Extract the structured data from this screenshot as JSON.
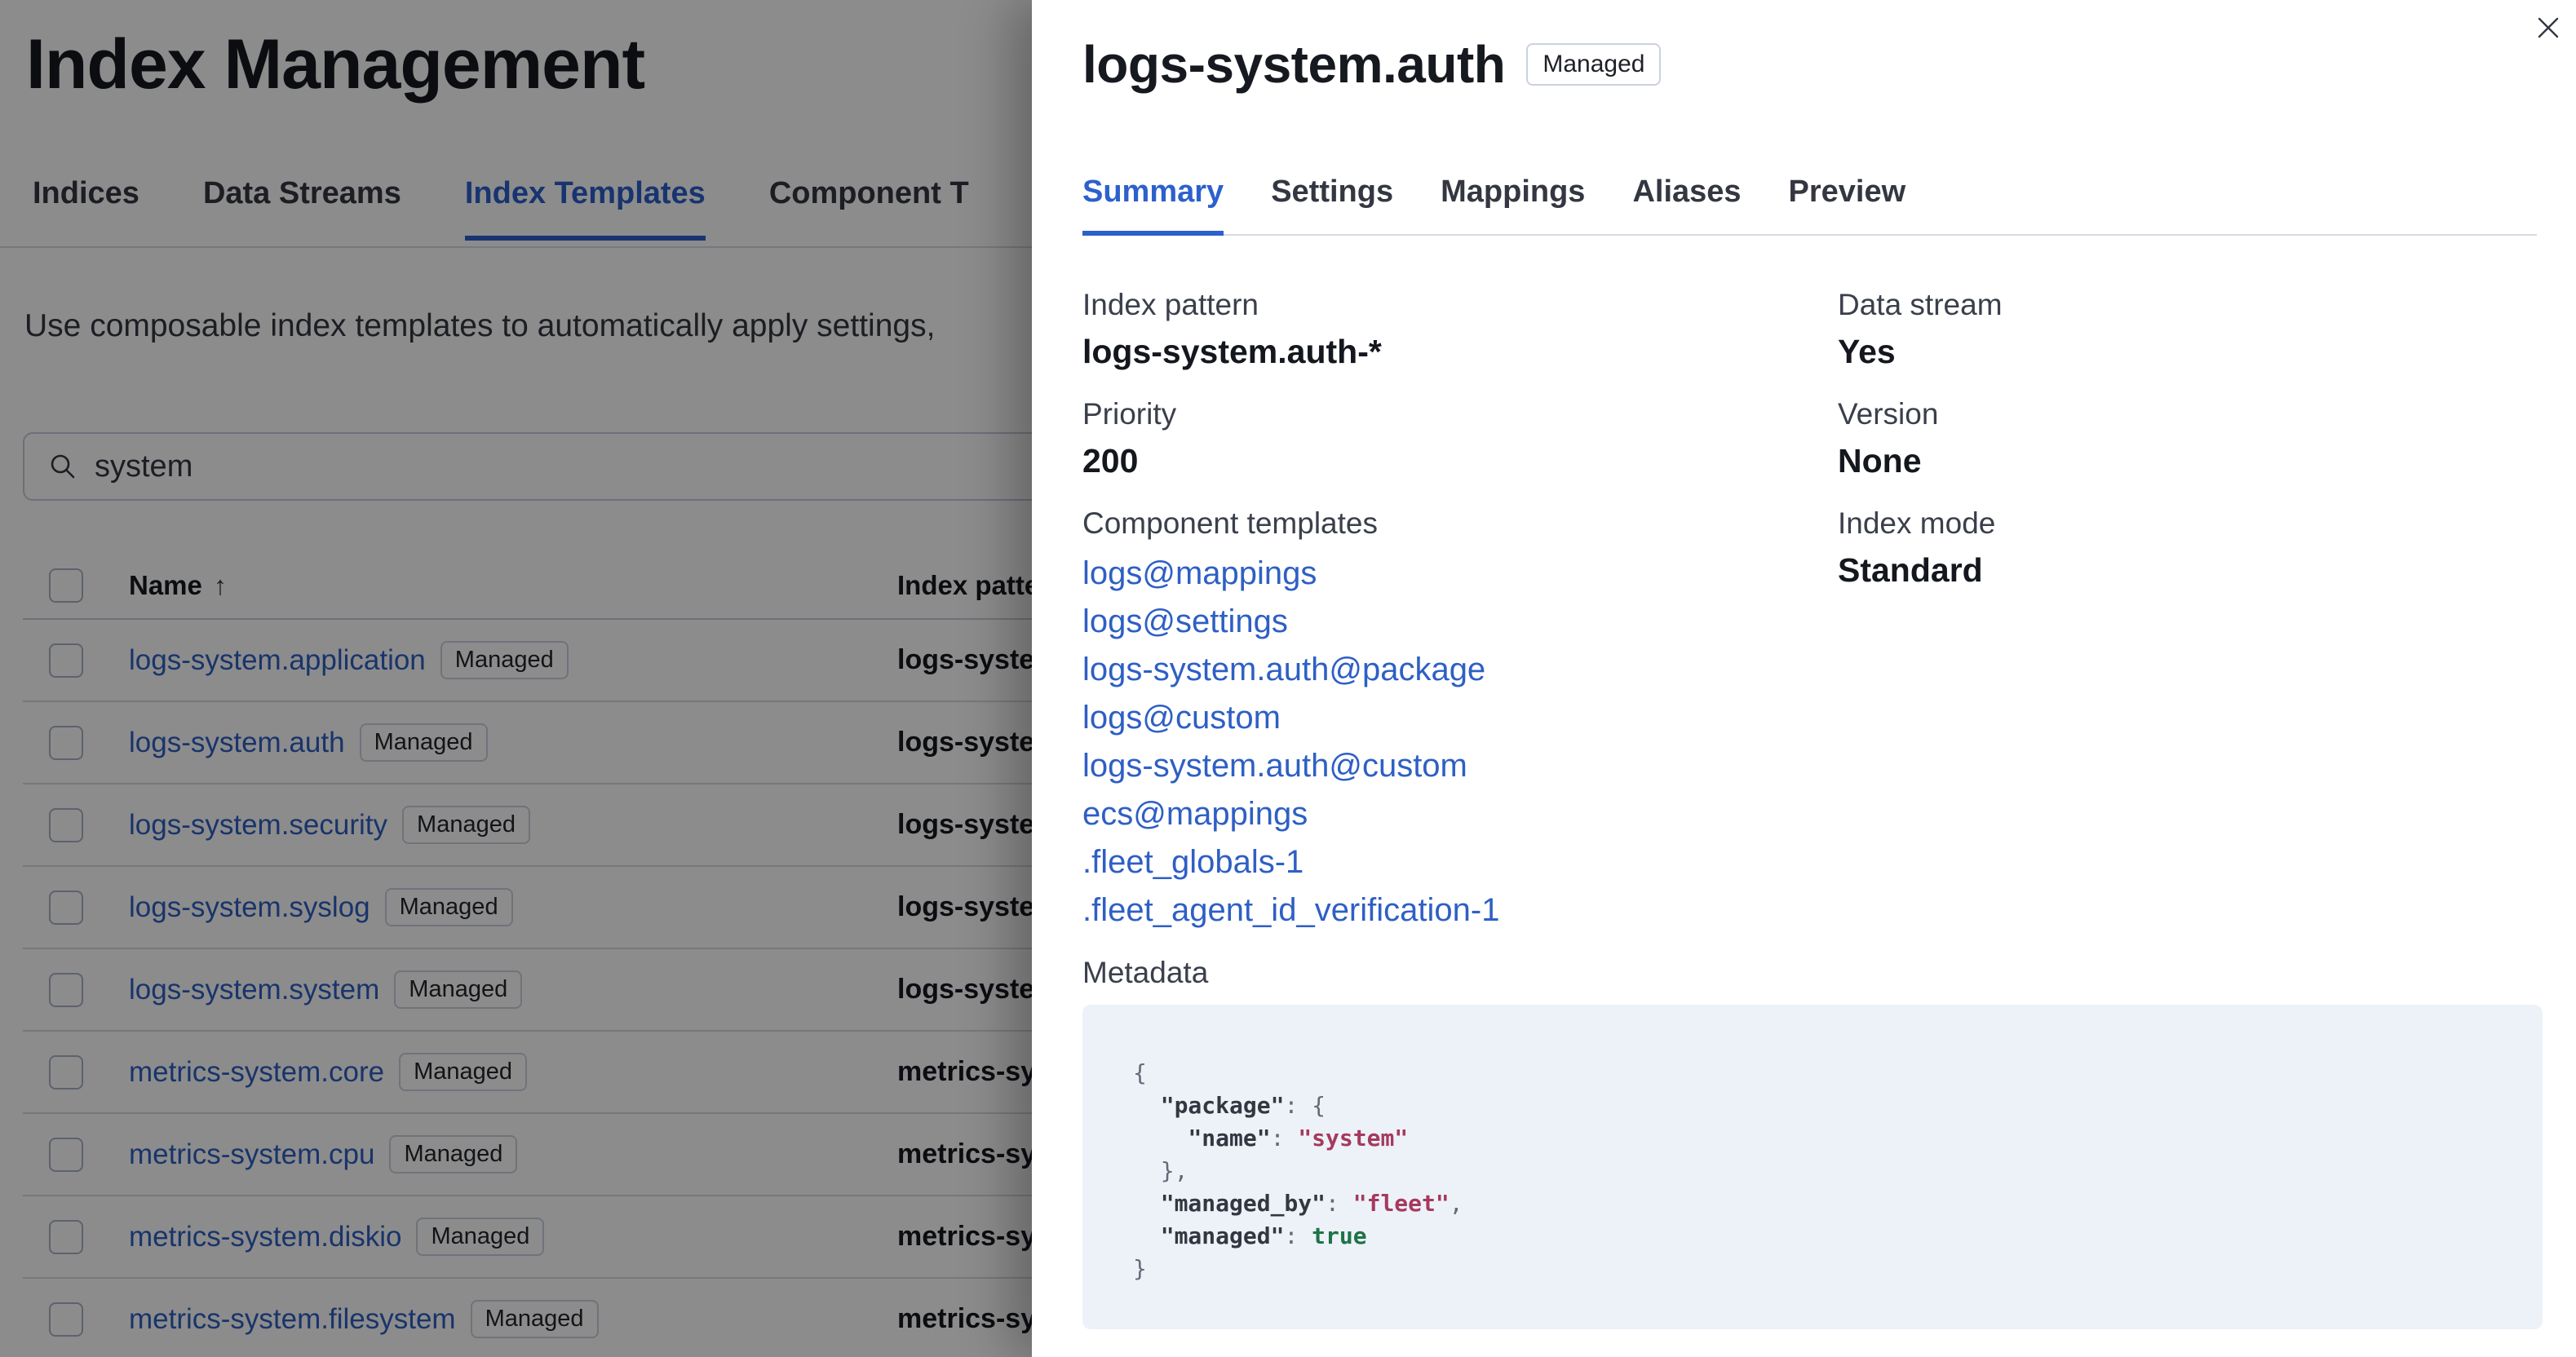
{
  "colors": {
    "link_blue": "#2E5FC4",
    "accent_blue": "#2D60CC",
    "text": "#343741",
    "text_strong": "#16191F",
    "code_background": "#EDF2F9",
    "code_string": "#A6395C",
    "code_boolean": "#1E7347",
    "overlay": "rgba(0,0,0,0.45)",
    "badge_border": "#CBD2DE"
  },
  "page": {
    "title": "Index Management",
    "tabs": [
      {
        "label": "Indices",
        "active": false
      },
      {
        "label": "Data Streams",
        "active": false
      },
      {
        "label": "Index Templates",
        "active": true
      },
      {
        "label": "Component T",
        "active": false
      }
    ],
    "description": "Use composable index templates to automatically apply settings,",
    "search": {
      "value": "system",
      "icon": "search-icon"
    },
    "table": {
      "columns": {
        "name": "Name",
        "sort_arrow": "↑",
        "index_pattern": "Index pattern"
      },
      "rows": [
        {
          "name": "logs-system.application",
          "badge": "Managed",
          "index_pattern": "logs-syste"
        },
        {
          "name": "logs-system.auth",
          "badge": "Managed",
          "index_pattern": "logs-syste"
        },
        {
          "name": "logs-system.security",
          "badge": "Managed",
          "index_pattern": "logs-syste"
        },
        {
          "name": "logs-system.syslog",
          "badge": "Managed",
          "index_pattern": "logs-syste"
        },
        {
          "name": "logs-system.system",
          "badge": "Managed",
          "index_pattern": "logs-syste"
        },
        {
          "name": "metrics-system.core",
          "badge": "Managed",
          "index_pattern": "metrics-sy"
        },
        {
          "name": "metrics-system.cpu",
          "badge": "Managed",
          "index_pattern": "metrics-sy"
        },
        {
          "name": "metrics-system.diskio",
          "badge": "Managed",
          "index_pattern": "metrics-sy"
        },
        {
          "name": "metrics-system.filesystem",
          "badge": "Managed",
          "index_pattern": "metrics-sy"
        }
      ]
    }
  },
  "flyout": {
    "title": "logs-system.auth",
    "badge": "Managed",
    "tabs": [
      {
        "label": "Summary",
        "active": true
      },
      {
        "label": "Settings",
        "active": false
      },
      {
        "label": "Mappings",
        "active": false
      },
      {
        "label": "Aliases",
        "active": false
      },
      {
        "label": "Preview",
        "active": false
      }
    ],
    "summary": {
      "left": [
        {
          "label": "Index pattern",
          "value": "logs-system.auth-*"
        },
        {
          "label": "Priority",
          "value": "200"
        },
        {
          "label": "Component templates",
          "links": [
            "logs@mappings",
            "logs@settings",
            "logs-system.auth@package",
            "logs@custom",
            "logs-system.auth@custom",
            "ecs@mappings",
            ".fleet_globals-1",
            ".fleet_agent_id_verification-1"
          ]
        }
      ],
      "right": [
        {
          "label": "Data stream",
          "value": "Yes"
        },
        {
          "label": "Version",
          "value": "None"
        },
        {
          "label": "Index mode",
          "value": "Standard"
        }
      ],
      "metadata_label": "Metadata",
      "metadata_code": [
        [
          {
            "t": "{",
            "c": "p"
          }
        ],
        [
          {
            "t": "  ",
            "c": "p"
          },
          {
            "t": "\"package\"",
            "c": "k"
          },
          {
            "t": ": {",
            "c": "p"
          }
        ],
        [
          {
            "t": "    ",
            "c": "p"
          },
          {
            "t": "\"name\"",
            "c": "k"
          },
          {
            "t": ": ",
            "c": "p"
          },
          {
            "t": "\"system\"",
            "c": "s"
          }
        ],
        [
          {
            "t": "  },",
            "c": "p"
          }
        ],
        [
          {
            "t": "  ",
            "c": "p"
          },
          {
            "t": "\"managed_by\"",
            "c": "k"
          },
          {
            "t": ": ",
            "c": "p"
          },
          {
            "t": "\"fleet\"",
            "c": "s"
          },
          {
            "t": ",",
            "c": "p"
          }
        ],
        [
          {
            "t": "  ",
            "c": "p"
          },
          {
            "t": "\"managed\"",
            "c": "k"
          },
          {
            "t": ": ",
            "c": "p"
          },
          {
            "t": "true",
            "c": "b"
          }
        ],
        [
          {
            "t": "}",
            "c": "p"
          }
        ]
      ]
    }
  }
}
